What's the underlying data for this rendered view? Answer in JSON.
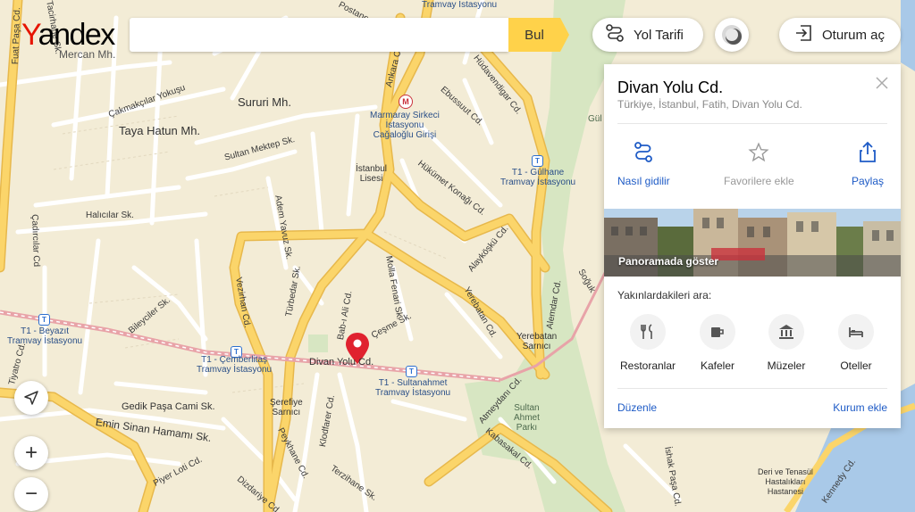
{
  "header": {
    "logo_first": "Y",
    "logo_rest": "andex",
    "search_value": "",
    "search_button": "Bul",
    "route_button": "Yol Tarifi",
    "login_button": "Oturum aç"
  },
  "panel": {
    "title": "Divan Yolu Cd.",
    "subtitle": "Türkiye, İstanbul, Fatih, Divan Yolu Cd.",
    "actions": [
      {
        "label": "Nasıl gidilir",
        "icon": "route-icon"
      },
      {
        "label": "Favorilere ekle",
        "icon": "star-icon"
      },
      {
        "label": "Paylaş",
        "icon": "share-icon"
      }
    ],
    "panorama_label": "Panoramada göster",
    "nearby_title": "Yakınlardakileri ara:",
    "categories": [
      {
        "label": "Restoranlar",
        "icon": "restaurant-icon"
      },
      {
        "label": "Kafeler",
        "icon": "cafe-icon"
      },
      {
        "label": "Müzeler",
        "icon": "museum-icon"
      },
      {
        "label": "Oteller",
        "icon": "hotel-icon"
      }
    ],
    "edit_link": "Düzenle",
    "add_org_link": "Kurum ekle"
  },
  "controls": {
    "zoom_in": "+",
    "zoom_out": "−"
  },
  "map": {
    "colors": {
      "background": "#f3ecd6",
      "main_road": "#fbd56a",
      "sea": "#a9c9e8",
      "park": "#d7e6c2"
    },
    "labels": {
      "mercan": "Mercan Mh.",
      "taya_hatun": "Taya Hatun Mh.",
      "sururi": "Sururi Mh.",
      "cakmakcilar": "Çakmakçılar Yokuşu",
      "sultan_mektep": "Sultan Mektep Sk.",
      "marmaray": "Marmaray Sirkeci\nİstasyonu\nCağaloğlu Girişi",
      "istanbul_lisesi": "İstanbul\nLisesi",
      "ebussuut": "Ebussuut Cd.",
      "hudavendigar": "Hüdavendigar Cd.",
      "hukumet_konagi": "Hükümet Konağı Cd.",
      "alaykosku": "Alayköşkü Cd.",
      "gulhane": "T1 - Gülhane\nTramvay İstasyonu",
      "halicilar": "Halıcılar Sk.",
      "adem_yavuz": "Adem Yavuz Sk.",
      "cadircilar": "Çadırcılar Cd",
      "vezirhan": "Vezirhan Cd.",
      "turbedar": "Türbedar Sk.",
      "babiali": "Bab-ı Ali Cd.",
      "molla_fenari": "Molla Fenari Sk.",
      "yerebatan": "Yerebatan Cd.",
      "yerebatan_sarnici": "Yerebatan\nSarnıcı",
      "alemdar": "Alemdar Cd.",
      "biliciler": "Bileyciler Sk.",
      "beyazit": "T1 - Beyazıt\nTramvay İstasyonu",
      "cemberlitas": "T1 - Çemberlitaş\nTramvay İstasyonu",
      "divan_yolu": "Divan Yolu Cd.",
      "cesme": "Çeşme Sk.",
      "sultanahmet_tram": "T1 - Sultanahmet\nTramvay İstasyonu",
      "tiyatro": "Tiyatro Cd.",
      "gedik_pasa": "Gedik Paşa Cami Sk.",
      "serefiye": "Şerefiye\nSarnıcı",
      "emin_sinan": "Emin Sinan Hamamı Sk.",
      "piyer_loti": "Piyer Loti Cd.",
      "peykhane": "Peykhane Cd.",
      "klodfarer": "Klodfarer Cd.",
      "terzihane": "Terzihane Sk.",
      "dizdariye": "Dizdariye Cd.",
      "atmeydani": "Atmeydanı Cd.",
      "sultanahmet_parki": "Sultan\nAhmet\nParkı",
      "kabasakal": "Kabasakal Cd.",
      "ishak_pasa": "İshak Paşa Cd.",
      "kennedy": "Kennedy Cd.",
      "deri": "Deri ve Tenasül\nHastalıkları\nHastanesi",
      "soguk": "Soğuk",
      "gul": "Gül",
      "fuat_pasa": "Fuat Paşa Cd.",
      "tacirler": "Tacirhane Sk.",
      "postane": "Postane",
      "tramvay_top": "Tramvay İstasyonu",
      "ankara": "Ankara Cd.",
      "sultan_hamami": "Sultan"
    }
  }
}
